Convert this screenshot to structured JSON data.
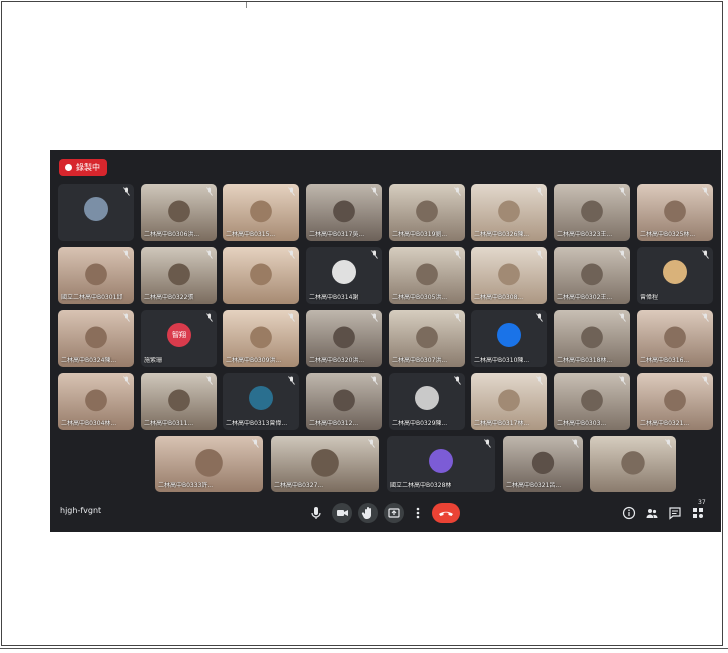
{
  "recording_label": "錄製中",
  "meeting_code": "hjgh-fvgnt",
  "participant_count": "37",
  "tiles": [
    {
      "name": "",
      "avatar": true,
      "avatar_color": "#7b8fa6"
    },
    {
      "name": "二林高中B0306洪..."
    },
    {
      "name": "二林高中B0315..."
    },
    {
      "name": "二林高中B0317吳..."
    },
    {
      "name": "二林高中B0319劉..."
    },
    {
      "name": "二林高中B0326陳..."
    },
    {
      "name": "二林高中B0323王..."
    },
    {
      "name": "二林高中B0325林..."
    },
    {
      "name": "國立二林高中B0301邱"
    },
    {
      "name": "二林高中B0322張"
    },
    {
      "name": ""
    },
    {
      "name": "二林高中B0314謝",
      "avatar": true,
      "avatar_color": "#e0e0e0"
    },
    {
      "name": "二林高中B0305洪..."
    },
    {
      "name": "二林高中B0308..."
    },
    {
      "name": "二林高中B0302王..."
    },
    {
      "name": "曾偉程",
      "avatar": true,
      "avatar_color": "#d9b27a"
    },
    {
      "name": "二林高中B0324陳..."
    },
    {
      "name": "施紫珊",
      "avatar": true,
      "avatar_letter": "智翔",
      "avatar_color": "#d93b4c"
    },
    {
      "name": "二林高中B0309洪..."
    },
    {
      "name": "二林高中B0320洪..."
    },
    {
      "name": "二林高中B0307洪..."
    },
    {
      "name": "二林高中B0310陳...",
      "avatar": true,
      "avatar_color": "#1a73e8"
    },
    {
      "name": "二林高中B0318林..."
    },
    {
      "name": "二林高中B0316..."
    },
    {
      "name": "二林高中B0304林..."
    },
    {
      "name": "二林高中B0311..."
    },
    {
      "name": "二林高中B0313曾偉...",
      "avatar": true,
      "avatar_color": "#2a6f8f"
    },
    {
      "name": "二林高中B0312..."
    },
    {
      "name": "二林高中B0329陳...",
      "avatar": true,
      "avatar_color": "#c9c9c9"
    },
    {
      "name": "二林高中B0317林..."
    },
    {
      "name": "二林高中B0303..."
    },
    {
      "name": "二林高中B0321..."
    },
    {
      "name": "二林高中B0333許..."
    },
    {
      "name": "二林高中B0327..."
    },
    {
      "name": "國立二林高中B0328林",
      "avatar": true,
      "avatar_color": "#7c5cd6"
    },
    {
      "name": "二林高中B0321呂..."
    },
    {
      "name": ""
    }
  ],
  "icons": {
    "mic": "mic-icon",
    "camera": "camera-icon",
    "hand": "raise-hand-icon",
    "present": "present-icon",
    "more": "more-options-icon",
    "end": "end-call-icon",
    "info": "info-icon",
    "people": "people-icon",
    "chat": "chat-icon",
    "activities": "activities-icon"
  }
}
